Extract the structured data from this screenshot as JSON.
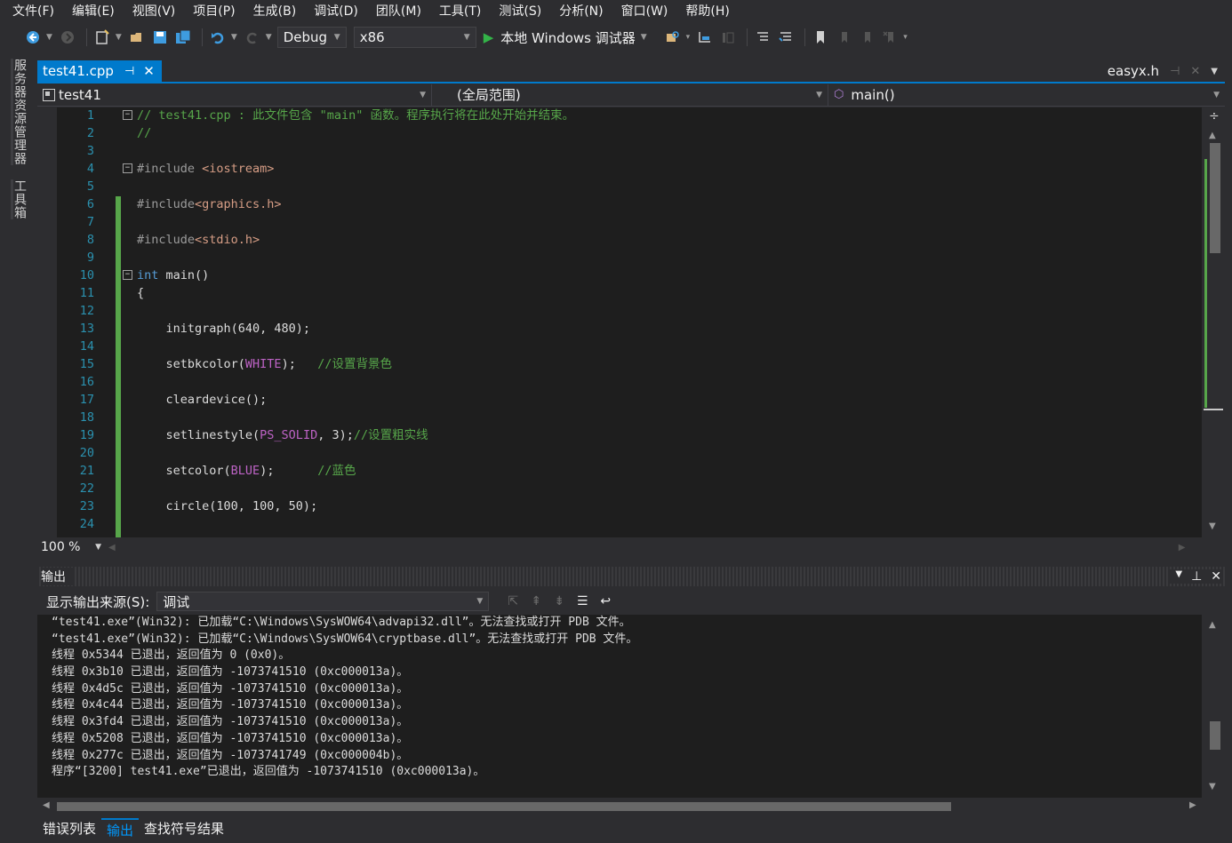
{
  "menu": [
    "文件(F)",
    "编辑(E)",
    "视图(V)",
    "项目(P)",
    "生成(B)",
    "调试(D)",
    "团队(M)",
    "工具(T)",
    "测试(S)",
    "分析(N)",
    "窗口(W)",
    "帮助(H)"
  ],
  "toolbar": {
    "configuration": "Debug",
    "platform": "x86",
    "run_label": "本地 Windows 调试器"
  },
  "sidebar": {
    "server_explorer": "服务器资源管理器",
    "toolbox": "工具箱"
  },
  "tabs": {
    "active": "test41.cpp",
    "right": "easyx.h"
  },
  "navbar": {
    "project": "test41",
    "scope": "(全局范围)",
    "member": "main()"
  },
  "editor": {
    "line_numbers": [
      "1",
      "2",
      "3",
      "4",
      "5",
      "6",
      "7",
      "8",
      "9",
      "10",
      "11",
      "12",
      "13",
      "14",
      "15",
      "16",
      "17",
      "18",
      "19",
      "20",
      "21",
      "22",
      "23",
      "24"
    ],
    "zoom": "100 %"
  },
  "code": {
    "l1_comment": "// test41.cpp : 此文件包含 \"main\" 函数。程序执行将在此处开始并结束。",
    "l2_comment": "//",
    "l4_pre": "#include ",
    "l4_str": "<iostream>",
    "l6_pre": "#include",
    "l6_str": "<graphics.h>",
    "l8_pre": "#include",
    "l8_str": "<stdio.h>",
    "l10_kw": "int",
    "l10_rest": " main()",
    "l11": "{",
    "l13": "    initgraph(640, 480);",
    "l15_a": "    setbkcolor(",
    "l15_macro": "WHITE",
    "l15_b": ");   ",
    "l15_comment": "//设置背景色",
    "l17": "    cleardevice();",
    "l19_a": "    setlinestyle(",
    "l19_macro": "PS_SOLID",
    "l19_b": ", 3);",
    "l19_comment": "//设置粗实线",
    "l21_a": "    setcolor(",
    "l21_macro": "BLUE",
    "l21_b": ");      ",
    "l21_comment": "//蓝色",
    "l23": "    circle(100, 100, 50);"
  },
  "output": {
    "title": "输出",
    "source_label": "显示输出来源(S):",
    "source_value": "调试",
    "lines": [
      "“test41.exe”(Win32): 已加载“C:\\Windows\\SysWOW64\\advapi32.dll”。无法查找或打开 PDB 文件。",
      "“test41.exe”(Win32): 已加载“C:\\Windows\\SysWOW64\\cryptbase.dll”。无法查找或打开 PDB 文件。",
      "线程 0x5344 已退出，返回值为 0 (0x0)。",
      "线程 0x3b10 已退出，返回值为 -1073741510 (0xc000013a)。",
      "线程 0x4d5c 已退出，返回值为 -1073741510 (0xc000013a)。",
      "线程 0x4c44 已退出，返回值为 -1073741510 (0xc000013a)。",
      "线程 0x3fd4 已退出，返回值为 -1073741510 (0xc000013a)。",
      "线程 0x5208 已退出，返回值为 -1073741510 (0xc000013a)。",
      "线程 0x277c 已退出，返回值为 -1073741749 (0xc000004b)。",
      "程序“[3200] test41.exe”已退出，返回值为 -1073741510 (0xc000013a)。"
    ]
  },
  "bottom_tabs": [
    "错误列表",
    "输出",
    "查找符号结果"
  ],
  "colors": {
    "accent": "#007acc",
    "comment": "#57a64a",
    "keyword": "#569cd6",
    "string": "#d69d85",
    "macro": "#bd63c5",
    "line_number": "#2b91af"
  }
}
